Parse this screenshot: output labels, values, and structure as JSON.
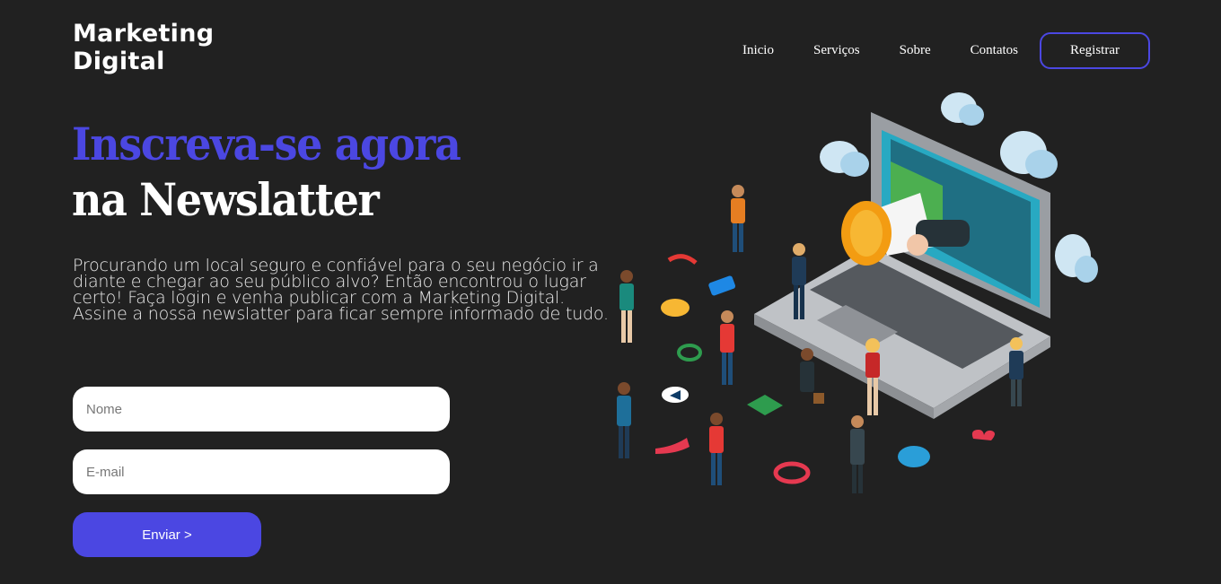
{
  "brand": {
    "line1": "Marketing",
    "line2": "Digital"
  },
  "nav": {
    "items": [
      "Inicio",
      "Serviços",
      "Sobre",
      "Contatos"
    ],
    "register_label": "Registrar"
  },
  "hero": {
    "title_accent": "Inscreva-se agora",
    "title_main": "na Newslatter",
    "description": "Procurando um local seguro e confiável para o seu negócio ir a diante e chegar ao seu público alvo? Então encontrou o lugar certo! Faça login e venha publicar com a Marketing Digital. Assine a nossa newslatter para ficar sempre informado de tudo."
  },
  "form": {
    "name_placeholder": "Nome",
    "email_placeholder": "E-mail",
    "submit_label": "Enviar >"
  },
  "colors": {
    "background": "#212121",
    "accent": "#4b47e2",
    "text": "#ffffff"
  },
  "illustration": {
    "icon": "laptop-megaphone-marketing-illustration"
  }
}
